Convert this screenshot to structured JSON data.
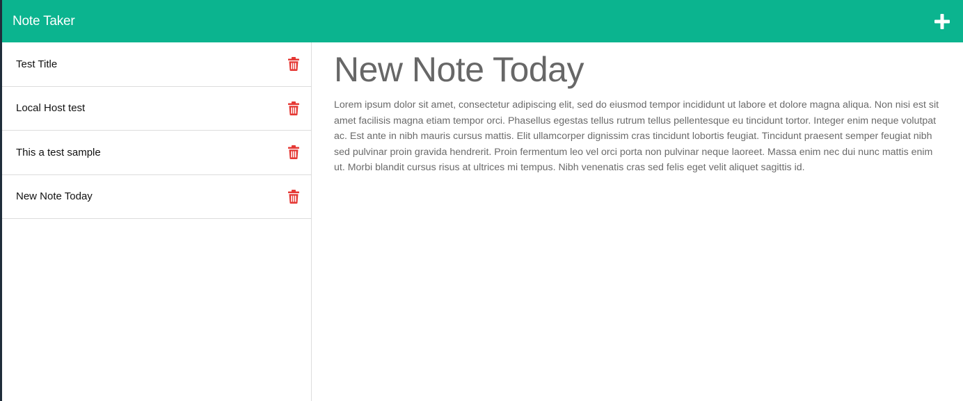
{
  "header": {
    "title": "Note Taker",
    "add_icon": "plus-icon",
    "background": "#0bb48f"
  },
  "sidebar": {
    "notes": [
      {
        "title": "Test Title",
        "icon": "trash-icon"
      },
      {
        "title": "Local Host test",
        "icon": "trash-icon"
      },
      {
        "title": "This a test sample",
        "icon": "trash-icon"
      },
      {
        "title": "New Note Today",
        "icon": "trash-icon"
      }
    ],
    "delete_color": "#e53935"
  },
  "main": {
    "title": "New Note Today",
    "body": "Lorem ipsum dolor sit amet, consectetur adipiscing elit, sed do eiusmod tempor incididunt ut labore et dolore magna aliqua. Non nisi est sit amet facilisis magna etiam tempor orci. Phasellus egestas tellus rutrum tellus pellentesque eu tincidunt tortor. Integer enim neque volutpat ac. Est ante in nibh mauris cursus mattis. Elit ullamcorper dignissim cras tincidunt lobortis feugiat. Tincidunt praesent semper feugiat nibh sed pulvinar proin gravida hendrerit. Proin fermentum leo vel orci porta non pulvinar neque laoreet. Massa enim nec dui nunc mattis enim ut. Morbi blandit cursus risus at ultrices mi tempus. Nibh venenatis cras sed felis eget velit aliquet sagittis id."
  }
}
